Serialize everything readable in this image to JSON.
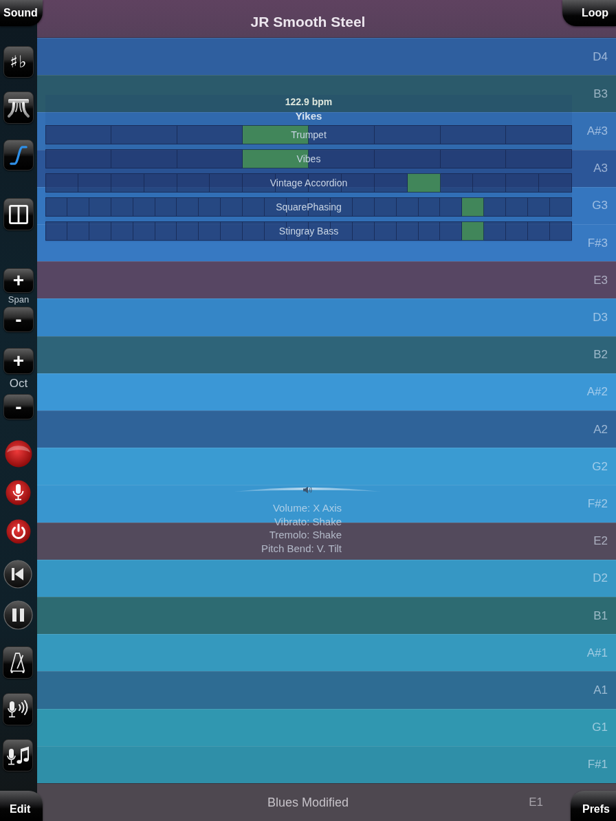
{
  "top_bar": {
    "left_button": "Sound",
    "title": "JR Smooth Steel",
    "right_button": "Loop"
  },
  "sidebar": {
    "accidentals_label": "♯♭",
    "span": {
      "increase": "+",
      "label": "Span",
      "decrease": "-"
    },
    "octave": {
      "increase": "+",
      "label": "Oct",
      "decrease": "-"
    }
  },
  "note_rows": [
    {
      "note": "D4",
      "color": "#2f5f9f"
    },
    {
      "note": "B3",
      "color": "#2b5a6b"
    },
    {
      "note": "A#3",
      "color": "#3470b5"
    },
    {
      "note": "A3",
      "color": "#2c5698"
    },
    {
      "note": "G3",
      "color": "#3576bf"
    },
    {
      "note": "F#3",
      "color": "#3779c2"
    },
    {
      "note": "E3",
      "color": "#574663"
    },
    {
      "note": "D3",
      "color": "#3586c7"
    },
    {
      "note": "B2",
      "color": "#2e6479"
    },
    {
      "note": "A#2",
      "color": "#3b97d6"
    },
    {
      "note": "A2",
      "color": "#2f6399"
    },
    {
      "note": "G2",
      "color": "#3a9bd2"
    },
    {
      "note": "F#2",
      "color": "#3996cf"
    },
    {
      "note": "E2",
      "color": "#534a5c"
    },
    {
      "note": "D2",
      "color": "#3697c4"
    },
    {
      "note": "B1",
      "color": "#2d6b72"
    },
    {
      "note": "A#1",
      "color": "#3599be"
    },
    {
      "note": "A1",
      "color": "#2e6c93"
    },
    {
      "note": "G1",
      "color": "#3097b0"
    },
    {
      "note": "F#1",
      "color": "#2f8fa8"
    }
  ],
  "sequencer": {
    "tempo": "122.9 bpm",
    "pattern": "Yikes",
    "tracks": [
      {
        "name": "Trumpet",
        "steps": [
          false,
          false,
          false,
          true,
          false,
          false,
          false,
          false
        ]
      },
      {
        "name": "Vibes",
        "steps": [
          false,
          false,
          false,
          true,
          false,
          false,
          false,
          false
        ]
      },
      {
        "name": "Vintage Accordion",
        "steps": [
          false,
          false,
          false,
          false,
          false,
          false,
          false,
          false,
          false,
          false,
          false,
          true,
          false,
          false,
          false,
          false
        ]
      },
      {
        "name": "SquarePhasing",
        "steps": [
          false,
          false,
          false,
          false,
          false,
          false,
          false,
          false,
          false,
          false,
          false,
          false,
          false,
          false,
          false,
          false,
          false,
          false,
          false,
          true,
          false,
          false,
          false,
          false
        ]
      },
      {
        "name": "Stingray Bass",
        "steps": [
          false,
          false,
          false,
          false,
          false,
          false,
          false,
          false,
          false,
          false,
          false,
          false,
          false,
          false,
          false,
          false,
          false,
          false,
          false,
          true,
          false,
          false,
          false,
          false
        ]
      }
    ]
  },
  "control_mappings": [
    "Volume: X Axis",
    "Vibrato: Shake",
    "Tremolo: Shake",
    "Pitch Bend: V. Tilt"
  ],
  "bottom_bar": {
    "left_button": "Edit",
    "scale": "Blues Modified",
    "root_note": "E1",
    "right_button": "Prefs"
  }
}
